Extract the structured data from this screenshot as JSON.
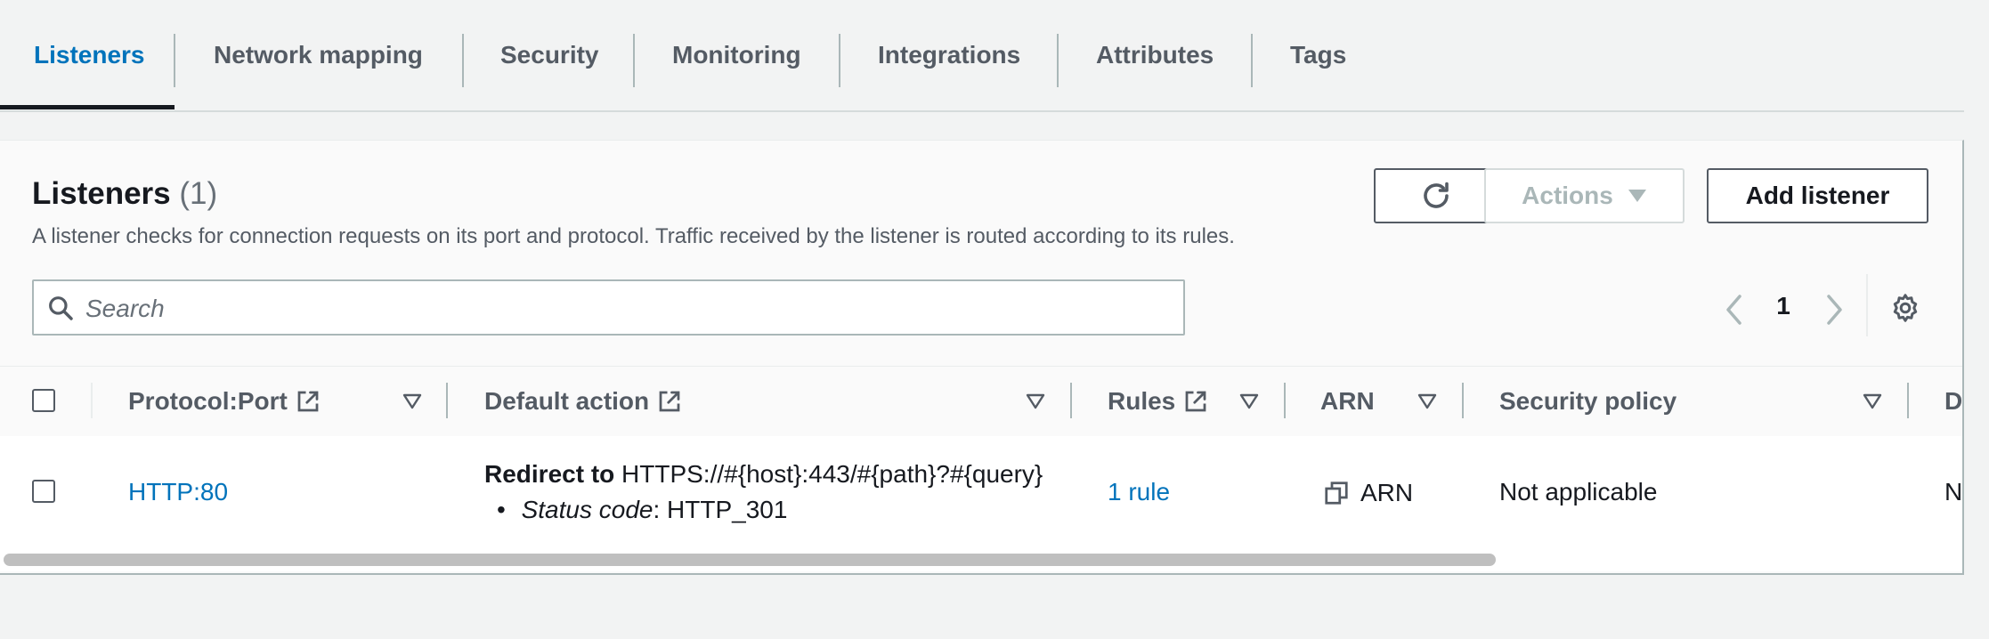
{
  "tabs": [
    {
      "label": "Listeners",
      "active": true
    },
    {
      "label": "Network mapping"
    },
    {
      "label": "Security"
    },
    {
      "label": "Monitoring"
    },
    {
      "label": "Integrations"
    },
    {
      "label": "Attributes"
    },
    {
      "label": "Tags"
    }
  ],
  "panel": {
    "title": "Listeners",
    "count": "(1)",
    "description": "A listener checks for connection requests on its port and protocol. Traffic received by the listener is routed according to its rules.",
    "refresh_icon": "refresh-icon",
    "actions_label": "Actions",
    "add_listener_label": "Add listener"
  },
  "search": {
    "placeholder": "Search",
    "value": "",
    "icon": "search-icon"
  },
  "pagination": {
    "current_page": "1",
    "settings_icon": "gear-icon"
  },
  "table": {
    "columns": [
      {
        "label": "Protocol:Port",
        "external_link": true
      },
      {
        "label": "Default action",
        "external_link": true
      },
      {
        "label": "Rules",
        "external_link": true
      },
      {
        "label": "ARN",
        "external_link": false
      },
      {
        "label": "Security policy",
        "external_link": false
      },
      {
        "label": "De",
        "external_link": false
      }
    ],
    "rows": [
      {
        "protocol_port": "HTTP:80",
        "default_action": {
          "prefix": "Redirect to",
          "target": "HTTPS://#{host}:443/#{path}?#{query}",
          "status_label": "Status code",
          "status_value": ": HTTP_301"
        },
        "rules": "1 rule",
        "arn": "ARN",
        "security_policy": "Not applicable",
        "truncated_cell": "N"
      }
    ]
  },
  "colors": {
    "link": "#0073bb",
    "text": "#16191f",
    "secondary_text": "#545b64",
    "background": "#f2f3f3",
    "panel": "#fafafa"
  }
}
